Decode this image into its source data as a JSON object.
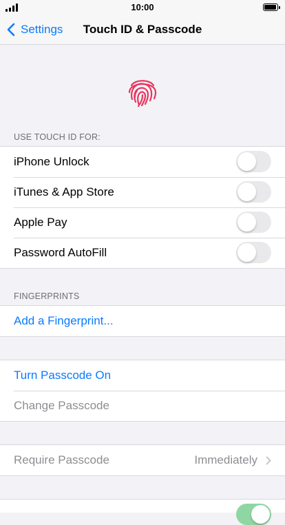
{
  "status_bar": {
    "time": "10:00"
  },
  "nav": {
    "back_label": "Settings",
    "title": "Touch ID & Passcode"
  },
  "touch_id": {
    "header": "USE TOUCH ID FOR:",
    "items": [
      {
        "label": "iPhone Unlock",
        "on": false
      },
      {
        "label": "iTunes & App Store",
        "on": false
      },
      {
        "label": "Apple Pay",
        "on": false
      },
      {
        "label": "Password AutoFill",
        "on": false
      }
    ]
  },
  "fingerprints": {
    "header": "FINGERPRINTS",
    "add_label": "Add a Fingerprint..."
  },
  "passcode": {
    "turn_on_label": "Turn Passcode On",
    "change_label": "Change Passcode"
  },
  "require": {
    "label": "Require Passcode",
    "value": "Immediately"
  },
  "colors": {
    "accent": "#0a7aff",
    "fingerprint": "#e8365e",
    "toggle_on": "#90d6a3"
  }
}
